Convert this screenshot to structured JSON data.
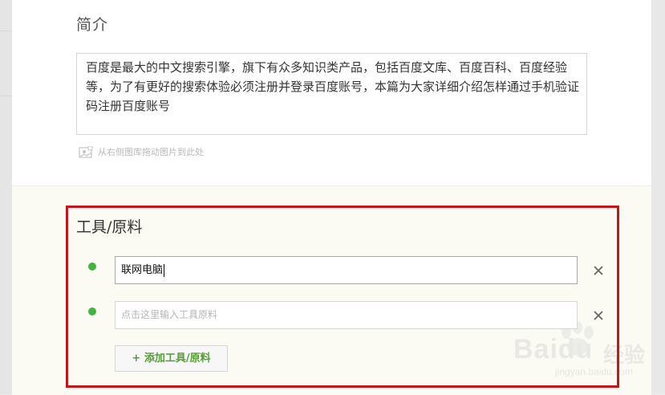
{
  "intro": {
    "title": "简介",
    "text": "百度是最大的中文搜索引擎，旗下有众多知识类产品，包括百度文库、百度百科、百度经验等，为了有更好的搜索体验必须注册并登录百度账号，本篇为大家详细介绍怎样通过手机验证码注册百度账号",
    "drag_hint": "从右侧图库拖动图片到此处",
    "drag_icon": "image-icon"
  },
  "tools": {
    "title": "工具/原料",
    "items": [
      {
        "value": "联网电脑",
        "placeholder": ""
      },
      {
        "value": "",
        "placeholder": "点击这里输入工具原料"
      }
    ],
    "add_label": "+ 添加工具/原料",
    "remove_icon": "close-icon",
    "bullet_color": "#3fb53f",
    "highlight_color": "#c8141a"
  },
  "watermark": {
    "brand": "Baidu",
    "brand_cn": "经验",
    "url": "jingyan.baidu.com"
  }
}
